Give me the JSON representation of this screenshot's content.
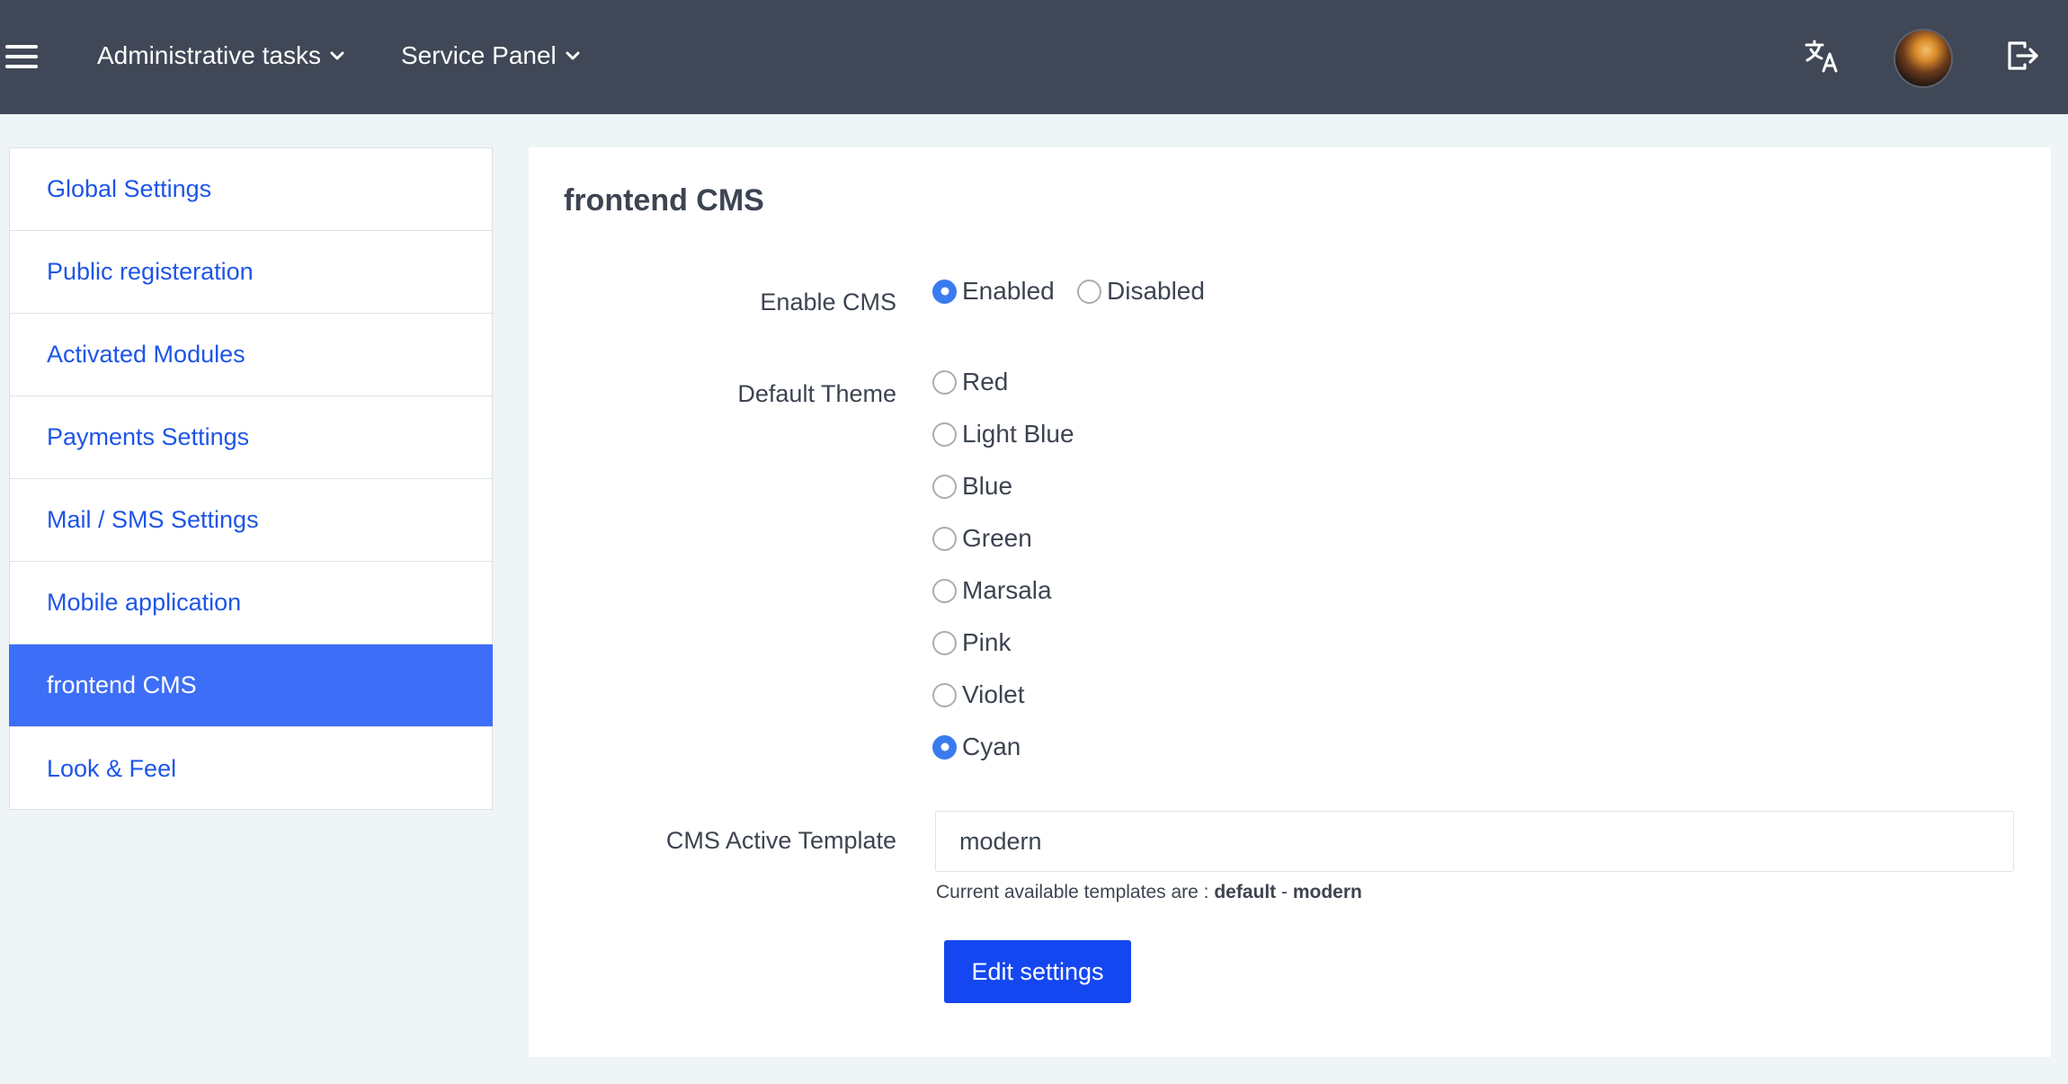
{
  "topbar": {
    "menus": [
      {
        "label": "Administrative tasks"
      },
      {
        "label": "Service Panel"
      }
    ],
    "icons": {
      "menu": "hamburger-menu-icon",
      "translate": "translate-icon",
      "avatar": "user-avatar",
      "logout": "logout-icon"
    },
    "colors": {
      "background": "#404756"
    }
  },
  "sidebar": {
    "items": [
      {
        "label": "Global Settings",
        "active": false
      },
      {
        "label": "Public registeration",
        "active": false
      },
      {
        "label": "Activated Modules",
        "active": false
      },
      {
        "label": "Payments Settings",
        "active": false
      },
      {
        "label": "Mail / SMS Settings",
        "active": false
      },
      {
        "label": "Mobile application",
        "active": false
      },
      {
        "label": "frontend CMS",
        "active": true
      },
      {
        "label": "Look & Feel",
        "active": false
      }
    ],
    "colors": {
      "link": "#1e55e8",
      "active_bg": "#3d6ef7"
    }
  },
  "main": {
    "title": "frontend CMS",
    "enable_cms": {
      "label": "Enable CMS",
      "options": [
        {
          "label": "Enabled",
          "checked": true
        },
        {
          "label": "Disabled",
          "checked": false
        }
      ]
    },
    "default_theme": {
      "label": "Default Theme",
      "options": [
        {
          "label": "Red",
          "checked": false
        },
        {
          "label": "Light Blue",
          "checked": false
        },
        {
          "label": "Blue",
          "checked": false
        },
        {
          "label": "Green",
          "checked": false
        },
        {
          "label": "Marsala",
          "checked": false
        },
        {
          "label": "Pink",
          "checked": false
        },
        {
          "label": "Violet",
          "checked": false
        },
        {
          "label": "Cyan",
          "checked": true
        }
      ]
    },
    "active_template": {
      "label": "CMS Active Template",
      "value": "modern",
      "help_prefix": "Current available templates are : ",
      "templates": [
        "default",
        "modern"
      ],
      "separator": " - "
    },
    "submit_label": "Edit settings",
    "colors": {
      "button": "#1447f0",
      "radio_checked": "#3a7bf0"
    }
  }
}
